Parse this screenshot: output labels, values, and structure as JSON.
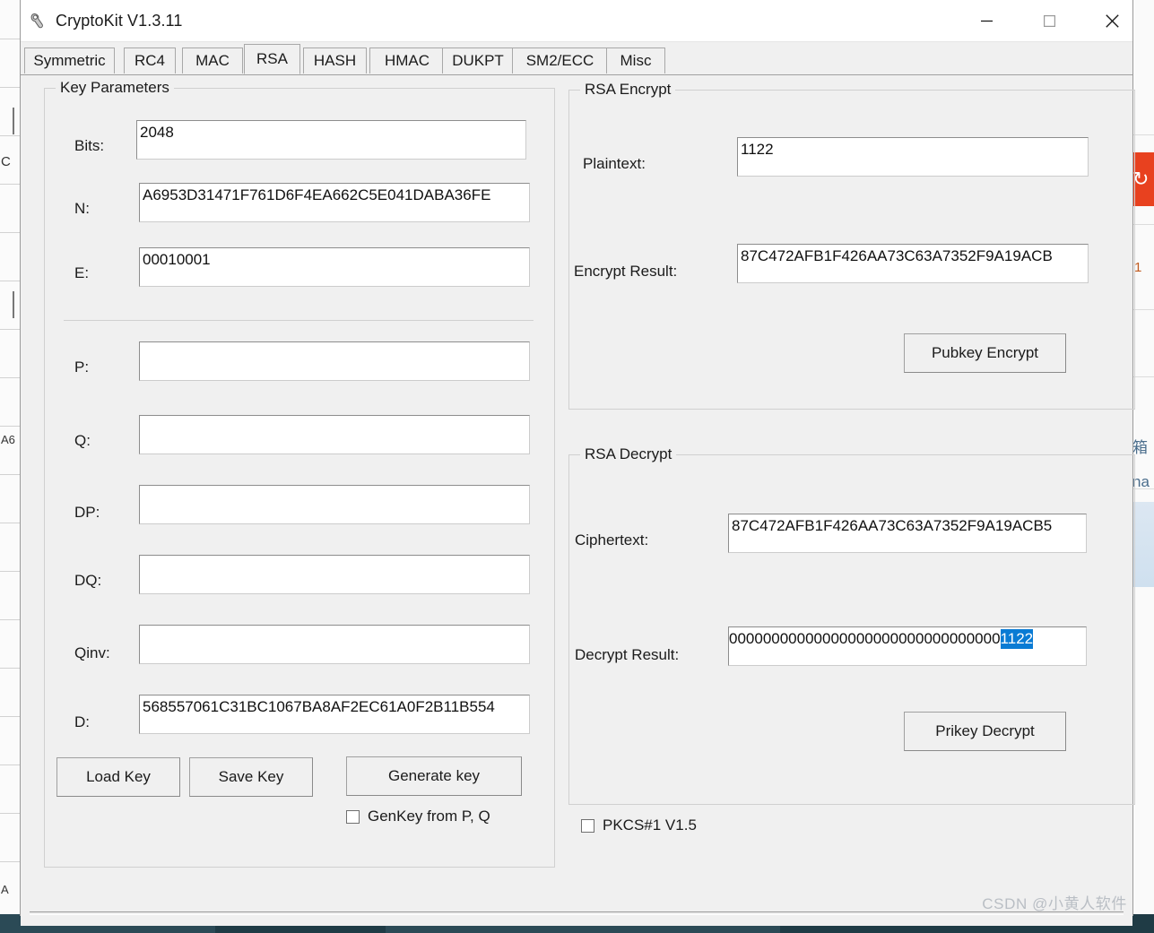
{
  "window": {
    "title": "CryptoKit V1.3.11",
    "icon": "wrench-icon",
    "minimize_label": "—",
    "maximize_label": "□",
    "close_label": "✕"
  },
  "tabs": [
    {
      "label": "Symmetric",
      "selected": false
    },
    {
      "label": "RC4",
      "selected": false
    },
    {
      "label": "MAC",
      "selected": false
    },
    {
      "label": "RSA",
      "selected": true
    },
    {
      "label": "HASH",
      "selected": false
    },
    {
      "label": "HMAC",
      "selected": false
    },
    {
      "label": "DUKPT",
      "selected": false
    },
    {
      "label": "SM2/ECC",
      "selected": false
    },
    {
      "label": "Misc",
      "selected": false
    }
  ],
  "key_parameters": {
    "title": "Key Parameters",
    "fields": [
      {
        "label": "Bits:",
        "value": "2048"
      },
      {
        "label": "N:",
        "value": "A6953D31471F761D6F4EA662C5E041DABA36FE"
      },
      {
        "label": "E:",
        "value": "00010001"
      },
      {
        "label": "P:",
        "value": ""
      },
      {
        "label": "Q:",
        "value": ""
      },
      {
        "label": "DP:",
        "value": ""
      },
      {
        "label": "DQ:",
        "value": ""
      },
      {
        "label": "Qinv:",
        "value": ""
      },
      {
        "label": "D:",
        "value": "568557061C31BC1067BA8AF2EC61A0F2B11B554"
      }
    ],
    "buttons": {
      "load_key": "Load Key",
      "save_key": "Save Key",
      "generate_key": "Generate key"
    },
    "genkey_from_pq": {
      "label": "GenKey from P, Q",
      "checked": false
    }
  },
  "rsa_encrypt": {
    "title": "RSA Encrypt",
    "plaintext_label": "Plaintext:",
    "plaintext_value": "1122",
    "encrypt_result_label": "Encrypt Result:",
    "encrypt_result_value": "87C472AFB1F426AA73C63A7352F9A19ACB",
    "button_label": "Pubkey Encrypt"
  },
  "rsa_decrypt": {
    "title": "RSA Decrypt",
    "ciphertext_label": "Ciphertext:",
    "ciphertext_value": "87C472AFB1F426AA73C63A7352F9A19ACB5",
    "decrypt_result_label": "Decrypt Result:",
    "decrypt_result_prefix": "00000000000000000000000000000000",
    "decrypt_result_selected": "1122",
    "button_label": "Prikey Decrypt"
  },
  "pkcs_checkbox": {
    "label": "PKCS#1 V1.5",
    "checked": false
  },
  "watermark": "CSDN @小黄人软件",
  "background": {
    "right_cjk_1": "箱",
    "right_cjk_2": "na",
    "right_number": "1"
  },
  "colors": {
    "window_bg": "#f0f0f0",
    "selection_blue": "#0a7bd4",
    "accent_orange": "#e8411f",
    "taskbar": "#1f3b45"
  }
}
